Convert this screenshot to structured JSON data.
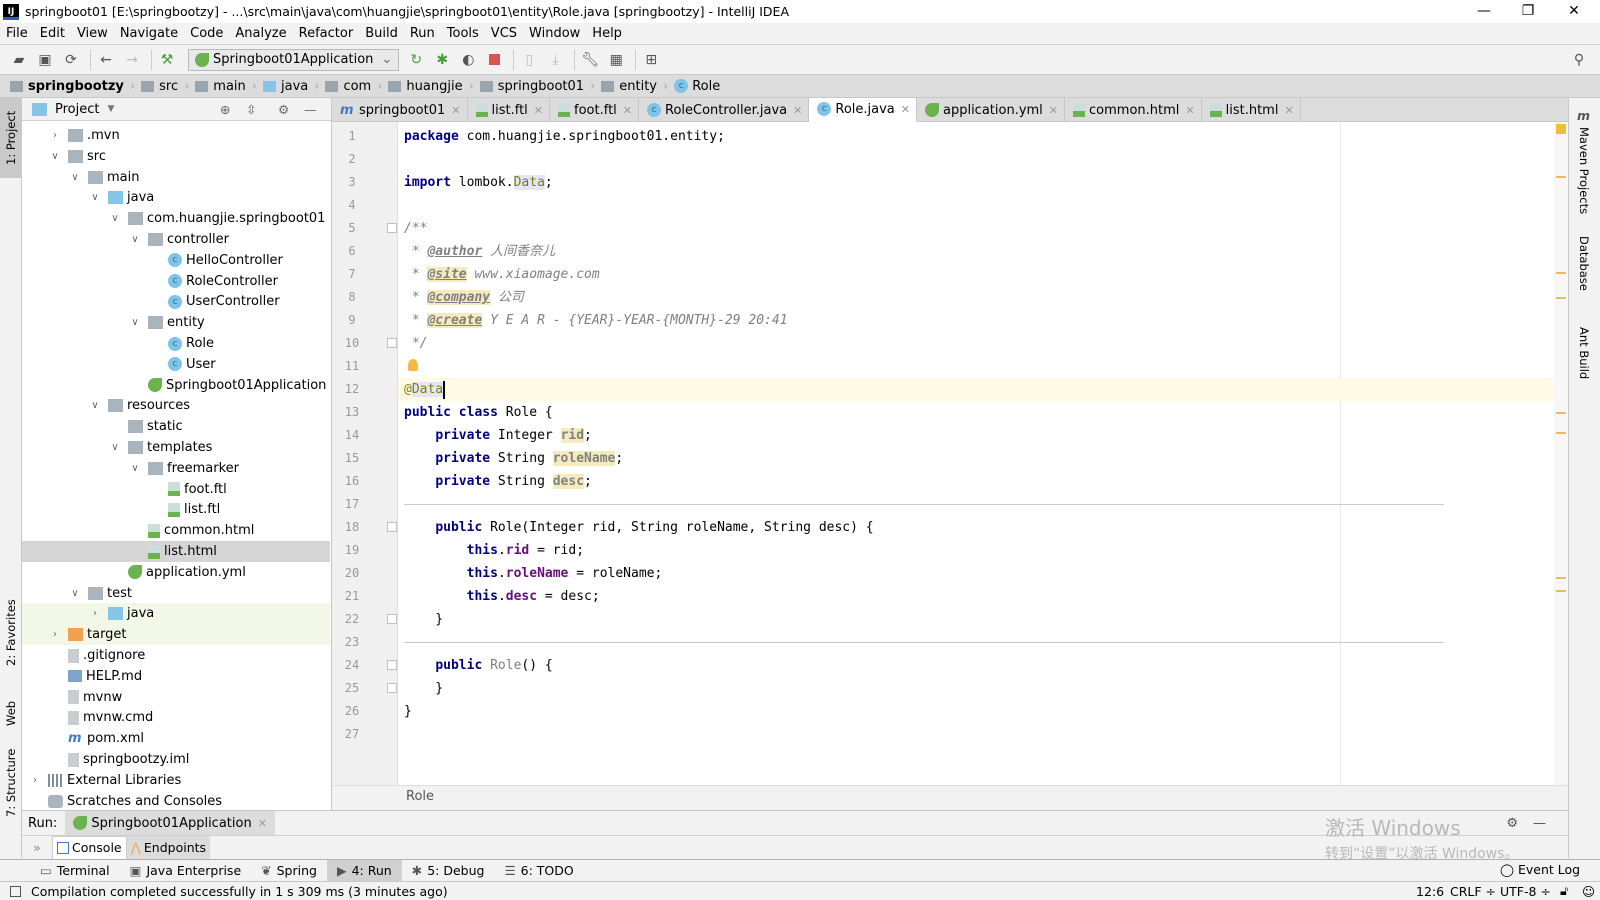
{
  "window": {
    "title": "springboot01 [E:\\springbootzy] - ...\\src\\main\\java\\com\\huangjie\\springboot01\\entity\\Role.java [springbootzy] - IntelliJ IDEA",
    "logo": "IJ",
    "controls": {
      "minimize": "—",
      "restore": "❐",
      "close": "✕"
    }
  },
  "menu": [
    "File",
    "Edit",
    "View",
    "Navigate",
    "Code",
    "Analyze",
    "Refactor",
    "Build",
    "Run",
    "Tools",
    "VCS",
    "Window",
    "Help"
  ],
  "toolbar": {
    "run_config": "Springboot01Application",
    "accent_run": "#4a9c3d",
    "accent_stop": "#d9534f"
  },
  "breadcrumbs": [
    "springbootzy",
    "src",
    "main",
    "java",
    "com",
    "huangjie",
    "springboot01",
    "entity",
    "Role"
  ],
  "left_stripe": [
    "1: Project",
    "2: Favorites",
    "Web",
    "7: Structure"
  ],
  "right_stripe": [
    "Maven Projects",
    "Database",
    "Ant Build"
  ],
  "project": {
    "title": "Project",
    "tree": [
      {
        "label": ".mvn",
        "depth": 1,
        "arrow": "›",
        "icon": "folder"
      },
      {
        "label": "src",
        "depth": 1,
        "arrow": "⌄",
        "icon": "folder"
      },
      {
        "label": "main",
        "depth": 2,
        "arrow": "⌄",
        "icon": "folder"
      },
      {
        "label": "java",
        "depth": 3,
        "arrow": "⌄",
        "icon": "srcfolder"
      },
      {
        "label": "com.huangjie.springboot01",
        "depth": 4,
        "arrow": "⌄",
        "icon": "pkg"
      },
      {
        "label": "controller",
        "depth": 5,
        "arrow": "⌄",
        "icon": "pkg"
      },
      {
        "label": "HelloController",
        "depth": 6,
        "arrow": "",
        "icon": "cls"
      },
      {
        "label": "RoleController",
        "depth": 6,
        "arrow": "",
        "icon": "cls"
      },
      {
        "label": "UserController",
        "depth": 6,
        "arrow": "",
        "icon": "cls"
      },
      {
        "label": "entity",
        "depth": 5,
        "arrow": "⌄",
        "icon": "pkg"
      },
      {
        "label": "Role",
        "depth": 6,
        "arrow": "",
        "icon": "cls"
      },
      {
        "label": "User",
        "depth": 6,
        "arrow": "",
        "icon": "cls"
      },
      {
        "label": "Springboot01Application",
        "depth": 5,
        "arrow": "",
        "icon": "spring"
      },
      {
        "label": "resources",
        "depth": 3,
        "arrow": "⌄",
        "icon": "folder"
      },
      {
        "label": "static",
        "depth": 4,
        "arrow": "",
        "icon": "folder"
      },
      {
        "label": "templates",
        "depth": 4,
        "arrow": "⌄",
        "icon": "folder"
      },
      {
        "label": "freemarker",
        "depth": 5,
        "arrow": "⌄",
        "icon": "folder"
      },
      {
        "label": "foot.ftl",
        "depth": 6,
        "arrow": "",
        "icon": "ftl"
      },
      {
        "label": "list.ftl",
        "depth": 6,
        "arrow": "",
        "icon": "ftl"
      },
      {
        "label": "common.html",
        "depth": 5,
        "arrow": "",
        "icon": "html"
      },
      {
        "label": "list.html",
        "depth": 5,
        "arrow": "",
        "icon": "html",
        "selected": true
      },
      {
        "label": "application.yml",
        "depth": 4,
        "arrow": "",
        "icon": "spring"
      },
      {
        "label": "test",
        "depth": 2,
        "arrow": "⌄",
        "icon": "folder"
      },
      {
        "label": "java",
        "depth": 3,
        "arrow": "›",
        "icon": "srcfolder",
        "highlight": true
      },
      {
        "label": "target",
        "depth": 1,
        "arrow": "›",
        "icon": "orange",
        "highlight": true
      },
      {
        "label": ".gitignore",
        "depth": 1,
        "arrow": "",
        "icon": "file"
      },
      {
        "label": "HELP.md",
        "depth": 1,
        "arrow": "",
        "icon": "md"
      },
      {
        "label": "mvnw",
        "depth": 1,
        "arrow": "",
        "icon": "file"
      },
      {
        "label": "mvnw.cmd",
        "depth": 1,
        "arrow": "",
        "icon": "file"
      },
      {
        "label": "pom.xml",
        "depth": 1,
        "arrow": "",
        "icon": "maven"
      },
      {
        "label": "springbootzy.iml",
        "depth": 1,
        "arrow": "",
        "icon": "file"
      },
      {
        "label": "External Libraries",
        "depth": 0,
        "arrow": "›",
        "icon": "lib"
      },
      {
        "label": "Scratches and Consoles",
        "depth": 0,
        "arrow": "",
        "icon": "scratch"
      }
    ]
  },
  "tabs": [
    {
      "label": "springboot01",
      "icon": "maven"
    },
    {
      "label": "list.ftl",
      "icon": "ftl"
    },
    {
      "label": "foot.ftl",
      "icon": "ftl"
    },
    {
      "label": "RoleController.java",
      "icon": "cls"
    },
    {
      "label": "Role.java",
      "icon": "cls",
      "active": true
    },
    {
      "label": "application.yml",
      "icon": "spring"
    },
    {
      "label": "common.html",
      "icon": "html"
    },
    {
      "label": "list.html",
      "icon": "html"
    }
  ],
  "editor": {
    "current_line": 12,
    "lines": [
      [
        {
          "t": "package",
          "c": "kw"
        },
        {
          "t": " com.huangjie.springboot01.entity;"
        }
      ],
      [],
      [
        {
          "t": "import",
          "c": "kw"
        },
        {
          "t": " lombok."
        },
        {
          "t": "Data",
          "c": "annhl"
        },
        {
          "t": ";"
        }
      ],
      [],
      [
        {
          "t": "/**",
          "c": "cm"
        }
      ],
      [
        {
          "t": " * ",
          "c": "cm"
        },
        {
          "t": "@author",
          "c": "tagn"
        },
        {
          "t": " 人间香奈儿",
          "c": "cm"
        }
      ],
      [
        {
          "t": " * ",
          "c": "cm"
        },
        {
          "t": "@site",
          "c": "tag"
        },
        {
          "t": " www.xiaomage.com",
          "c": "cm"
        }
      ],
      [
        {
          "t": " * ",
          "c": "cm"
        },
        {
          "t": "@company",
          "c": "tag"
        },
        {
          "t": " 公司",
          "c": "cm"
        }
      ],
      [
        {
          "t": " * ",
          "c": "cm"
        },
        {
          "t": "@create",
          "c": "tag"
        },
        {
          "t": " Y E A R - {YEAR}-YEAR-{MONTH}-29 20:41",
          "c": "cm"
        }
      ],
      [
        {
          "t": " */",
          "c": "cm"
        }
      ],
      [],
      [
        {
          "t": "@",
          "c": "ann"
        },
        {
          "t": "Data",
          "c": "annhl"
        }
      ],
      [
        {
          "t": "public class",
          "c": "kw"
        },
        {
          "t": " Role {"
        }
      ],
      [
        {
          "t": "    "
        },
        {
          "t": "private",
          "c": "kw"
        },
        {
          "t": " Integer "
        },
        {
          "t": "rid",
          "c": "fldhl"
        },
        {
          "t": ";"
        }
      ],
      [
        {
          "t": "    "
        },
        {
          "t": "private",
          "c": "kw"
        },
        {
          "t": " String "
        },
        {
          "t": "roleName",
          "c": "fldhl"
        },
        {
          "t": ";"
        }
      ],
      [
        {
          "t": "    "
        },
        {
          "t": "private",
          "c": "kw"
        },
        {
          "t": " String "
        },
        {
          "t": "desc",
          "c": "fldhl"
        },
        {
          "t": ";"
        }
      ],
      [],
      [
        {
          "t": "    "
        },
        {
          "t": "public",
          "c": "kw"
        },
        {
          "t": " Role(Integer rid, String roleName, String desc) {"
        }
      ],
      [
        {
          "t": "        "
        },
        {
          "t": "this",
          "c": "kw"
        },
        {
          "t": "."
        },
        {
          "t": "rid",
          "c": "fld"
        },
        {
          "t": " = rid;"
        }
      ],
      [
        {
          "t": "        "
        },
        {
          "t": "this",
          "c": "kw"
        },
        {
          "t": "."
        },
        {
          "t": "roleName",
          "c": "fld"
        },
        {
          "t": " = roleName;"
        }
      ],
      [
        {
          "t": "        "
        },
        {
          "t": "this",
          "c": "kw"
        },
        {
          "t": "."
        },
        {
          "t": "desc",
          "c": "fld"
        },
        {
          "t": " = desc;"
        }
      ],
      [
        {
          "t": "    }"
        }
      ],
      [],
      [
        {
          "t": "    "
        },
        {
          "t": "public",
          "c": "kw"
        },
        {
          "t": " "
        },
        {
          "t": "Role",
          "c": "gray"
        },
        {
          "t": "() {"
        }
      ],
      [
        {
          "t": "    }"
        }
      ],
      [
        {
          "t": "}"
        }
      ],
      []
    ],
    "breadcrumb": "Role"
  },
  "run_panel": {
    "label": "Run:",
    "config": "Springboot01Application",
    "subtabs": [
      "Console",
      "Endpoints"
    ]
  },
  "tool_windows": [
    "Terminal",
    "Java Enterprise",
    "Spring",
    "4: Run",
    "5: Debug",
    "6: TODO"
  ],
  "event_log": "Event Log",
  "watermark": {
    "line1": "激活 Windows",
    "line2": "转到“设置”以激活 Windows。"
  },
  "status": {
    "message": "Compilation completed successfully in 1 s 309 ms (3 minutes ago)",
    "position": "12:6",
    "line_sep": "CRLF ÷",
    "encoding": "UTF-8 ÷"
  }
}
